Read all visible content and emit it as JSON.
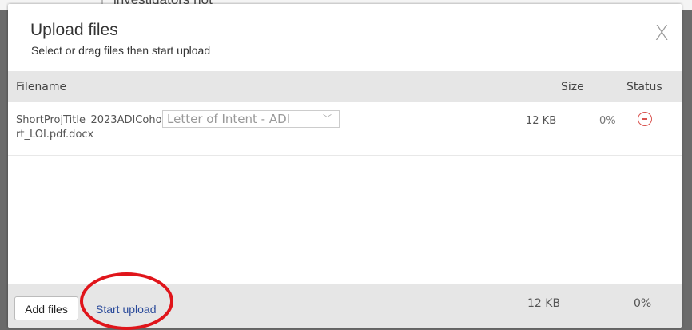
{
  "backdrop": {
    "peek_text": "investigators not"
  },
  "dialog": {
    "title": "Upload files",
    "subtitle": "Select or drag files then start upload",
    "close_label": "X"
  },
  "columns": {
    "filename": "Filename",
    "size": "Size",
    "status": "Status"
  },
  "files": [
    {
      "name": "ShortProjTitle_2023ADICohort_LOI.pdf.docx",
      "type_selected": "Letter of Intent - ADI",
      "size": "12 KB",
      "status": "0%"
    }
  ],
  "footer": {
    "add_label": "Add files",
    "start_label": "Start upload",
    "total_size": "12 KB",
    "total_status": "0%"
  },
  "colors": {
    "highlight": "#e0151b",
    "remove": "#d9534f",
    "link": "#2a4a9a"
  },
  "icons": {
    "close": "close-icon",
    "remove": "remove-circle-icon",
    "dropdown": "chevron-down-icon"
  }
}
